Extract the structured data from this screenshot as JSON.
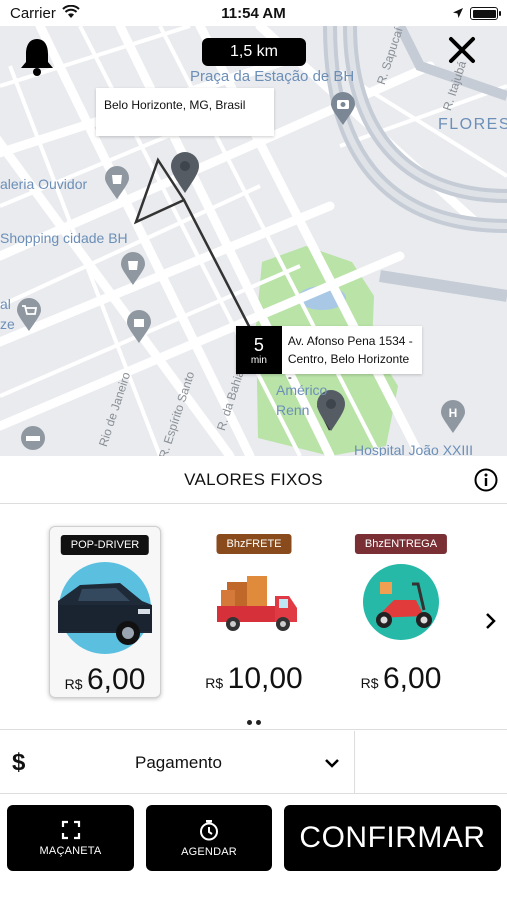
{
  "status_bar": {
    "carrier": "Carrier",
    "time": "11:54 AM"
  },
  "map": {
    "distance": "1,5 km",
    "origin_address": "Belo Horizonte, MG, Brasil",
    "eta_value": "5",
    "eta_unit": "min",
    "destination_line1": "Av. Afonso Pena 1534 -",
    "destination_line2": "Centro, Belo Horizonte -",
    "labels": {
      "praca": "Praça da Estação de BH",
      "flores": "FLORES",
      "galeria": "aleria Ouvidor",
      "shopping": "Shopping cidade BH",
      "al": "al",
      "ze": "ze",
      "americo": "Américo",
      "renn": "Renn",
      "hospital": "Hospital João XXIII",
      "r_sapucai": "R. Sapucaí",
      "r_itajuba": "R. Itajubá",
      "rio_janeiro": "Rio de Janeiro",
      "espirito_santo": "R. Espírito Santo",
      "da_bahia": "R. da Bahia"
    },
    "park_color": "#b9e3a7",
    "route_color": "#333333"
  },
  "fixed_values": {
    "title": "VALORES FIXOS"
  },
  "categories": [
    {
      "tag": "POP-DRIVER",
      "currency": "R$",
      "price": "6,00",
      "tag_color": "#111111",
      "icon": "car-icon",
      "selected": true
    },
    {
      "tag": "BhzFRETE",
      "currency": "R$",
      "price": "10,00",
      "tag_color": "#8a4b1c",
      "icon": "truck-icon",
      "selected": false
    },
    {
      "tag": "BhzENTREGA",
      "currency": "R$",
      "price": "6,00",
      "tag_color": "#7a2f35",
      "icon": "scooter-icon",
      "selected": false
    }
  ],
  "payment": {
    "currency_symbol": "$",
    "label": "Pagamento"
  },
  "actions": {
    "macaneta": "MAÇANETA",
    "agendar": "AGENDAR",
    "confirmar": "CONFIRMAR"
  }
}
